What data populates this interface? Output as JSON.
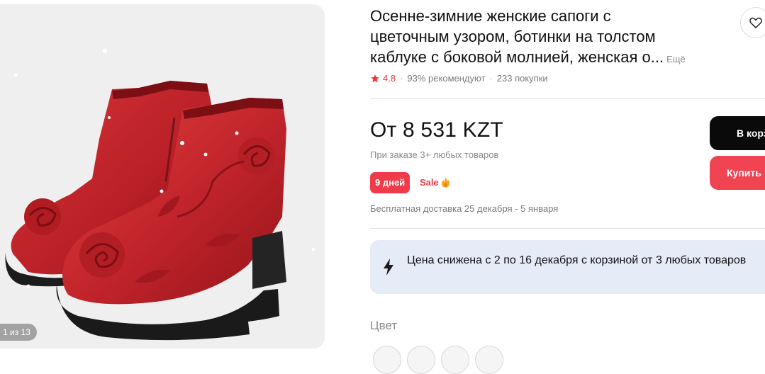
{
  "gallery": {
    "counter": "1 из 13"
  },
  "product": {
    "title_lines": [
      "Осенне-зимние женские сапоги с",
      "цветочным узором, ботинки на толстом",
      "каблуке с боковой молнией, женская о..."
    ],
    "more_label": "Ещё",
    "rating": "4.8",
    "recommend": "93% рекомендуют",
    "purchases": "233 покупки"
  },
  "pricing": {
    "price": "От 8 531 KZT",
    "note": "При заказе 3+ любых товаров",
    "days_badge": "9 дней",
    "sale_label": "Sale",
    "delivery": "Бесплатная доставка 25 декабря - 5 января"
  },
  "actions": {
    "cart_label": "В корзину",
    "buy_label": "Купить"
  },
  "promo": {
    "text": "Цена снижена с 2 по 16 декабря с корзиной от 3 любых товаров"
  },
  "color": {
    "label": "Цвет"
  },
  "colors": {
    "accent": "#ef3b4a",
    "star": "#e83a3a",
    "promo_bg": "#e6ebf8",
    "cart_bg": "#0a0a0a"
  },
  "icons": {
    "favorite": "heart-icon",
    "rating": "star-icon",
    "sale": "fire-icon",
    "promo": "lightning-icon"
  }
}
